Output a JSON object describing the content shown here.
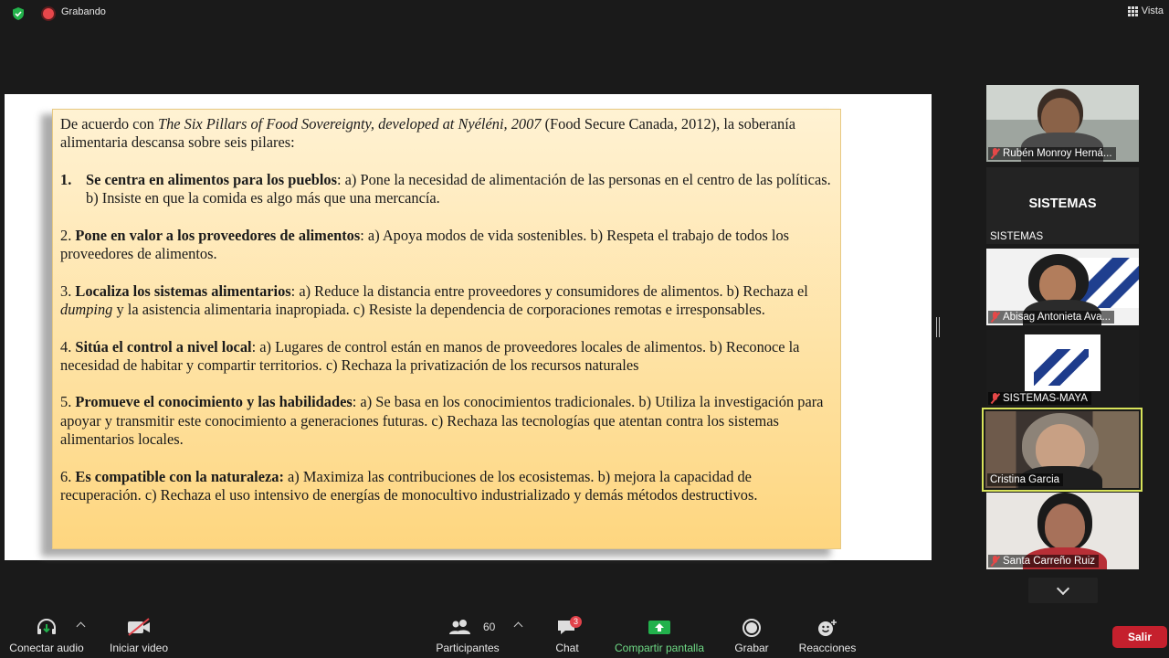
{
  "top_bar": {
    "recording_label": "Grabando",
    "view_label": "Vista"
  },
  "slide": {
    "intro_prefix": "De acuerdo con ",
    "intro_italic": "The Six Pillars of Food Sovereignty, developed at Nyéléni, 2007",
    "intro_suffix": " (Food Secure Canada, 2012), la soberanía alimentaria descansa sobre seis pilares:",
    "p1_num": "1.",
    "p1_title": "Se centra en alimentos para los pueblos",
    "p1_text": ": a) Pone la necesidad de alimentación de las personas en el centro de las políticas. b) Insiste en que la comida es algo más que una mercancía.",
    "p2_num": "2. ",
    "p2_title": "Pone en valor a los proveedores de alimentos",
    "p2_text": ": a) Apoya modos de vida sostenibles. b) Respeta el trabajo de todos los proveedores de alimentos.",
    "p3_num": "3. ",
    "p3_title": "Localiza los sistemas alimentarios",
    "p3_text_a": ": a) Reduce la distancia entre proveedores y consumidores de alimentos. b) Rechaza el ",
    "p3_italic": "dumping",
    "p3_text_b": " y la asistencia alimentaria inapropiada. c) Resiste la dependencia de corporaciones remotas e irresponsables.",
    "p4_num": "4. ",
    "p4_title": "Sitúa el control a nivel local",
    "p4_text": ": a) Lugares de control están en manos de proveedores locales de alimentos. b) Reconoce la necesidad de habitar y compartir territorios. c) Rechaza la privatización de los recursos naturales",
    "p5_num": "5. ",
    "p5_title": "Promueve el conocimiento y las habilidades",
    "p5_text": ": a) Se basa en los conocimientos tradicionales. b) Utiliza la investigación para apoyar y transmitir este conocimiento a generaciones futuras. c) Rechaza las tecnologías que atentan contra los sistemas alimentarios locales.",
    "p6_num": "6. ",
    "p6_title": "Es compatible con la naturaleza:",
    "p6_text": " a) Maximiza las contribuciones de los ecosistemas. b) mejora la capacidad de recuperación. c) Rechaza el uso intensivo de energías de monocultivo industrializado y demás métodos destructivos."
  },
  "participants": [
    {
      "name": "Rubén Monroy Herná...",
      "muted": true
    },
    {
      "name": "SISTEMAS",
      "big_label": "SISTEMAS",
      "muted": false
    },
    {
      "name": "Abisag Antonieta Ava...",
      "muted": true
    },
    {
      "name": "SISTEMAS-MAYA",
      "muted": true
    },
    {
      "name": "Cristina Garcia",
      "muted": false,
      "active_speaker": true
    },
    {
      "name": "Santa Carreño Ruiz",
      "muted": true
    }
  ],
  "toolbar": {
    "audio_label": "Conectar audio",
    "video_label": "Iniciar video",
    "participants_label": "Participantes",
    "participants_count": "60",
    "chat_label": "Chat",
    "chat_badge": "3",
    "share_label": "Compartir pantalla",
    "record_label": "Grabar",
    "reactions_label": "Reacciones",
    "leave_label": "Salir"
  },
  "colors": {
    "share_green": "#22b14c",
    "leave_red": "#c5202d",
    "active_speaker": "#d8e35a",
    "slide_gradient_top": "#fff2d3",
    "slide_gradient_bottom": "#fed67f"
  }
}
